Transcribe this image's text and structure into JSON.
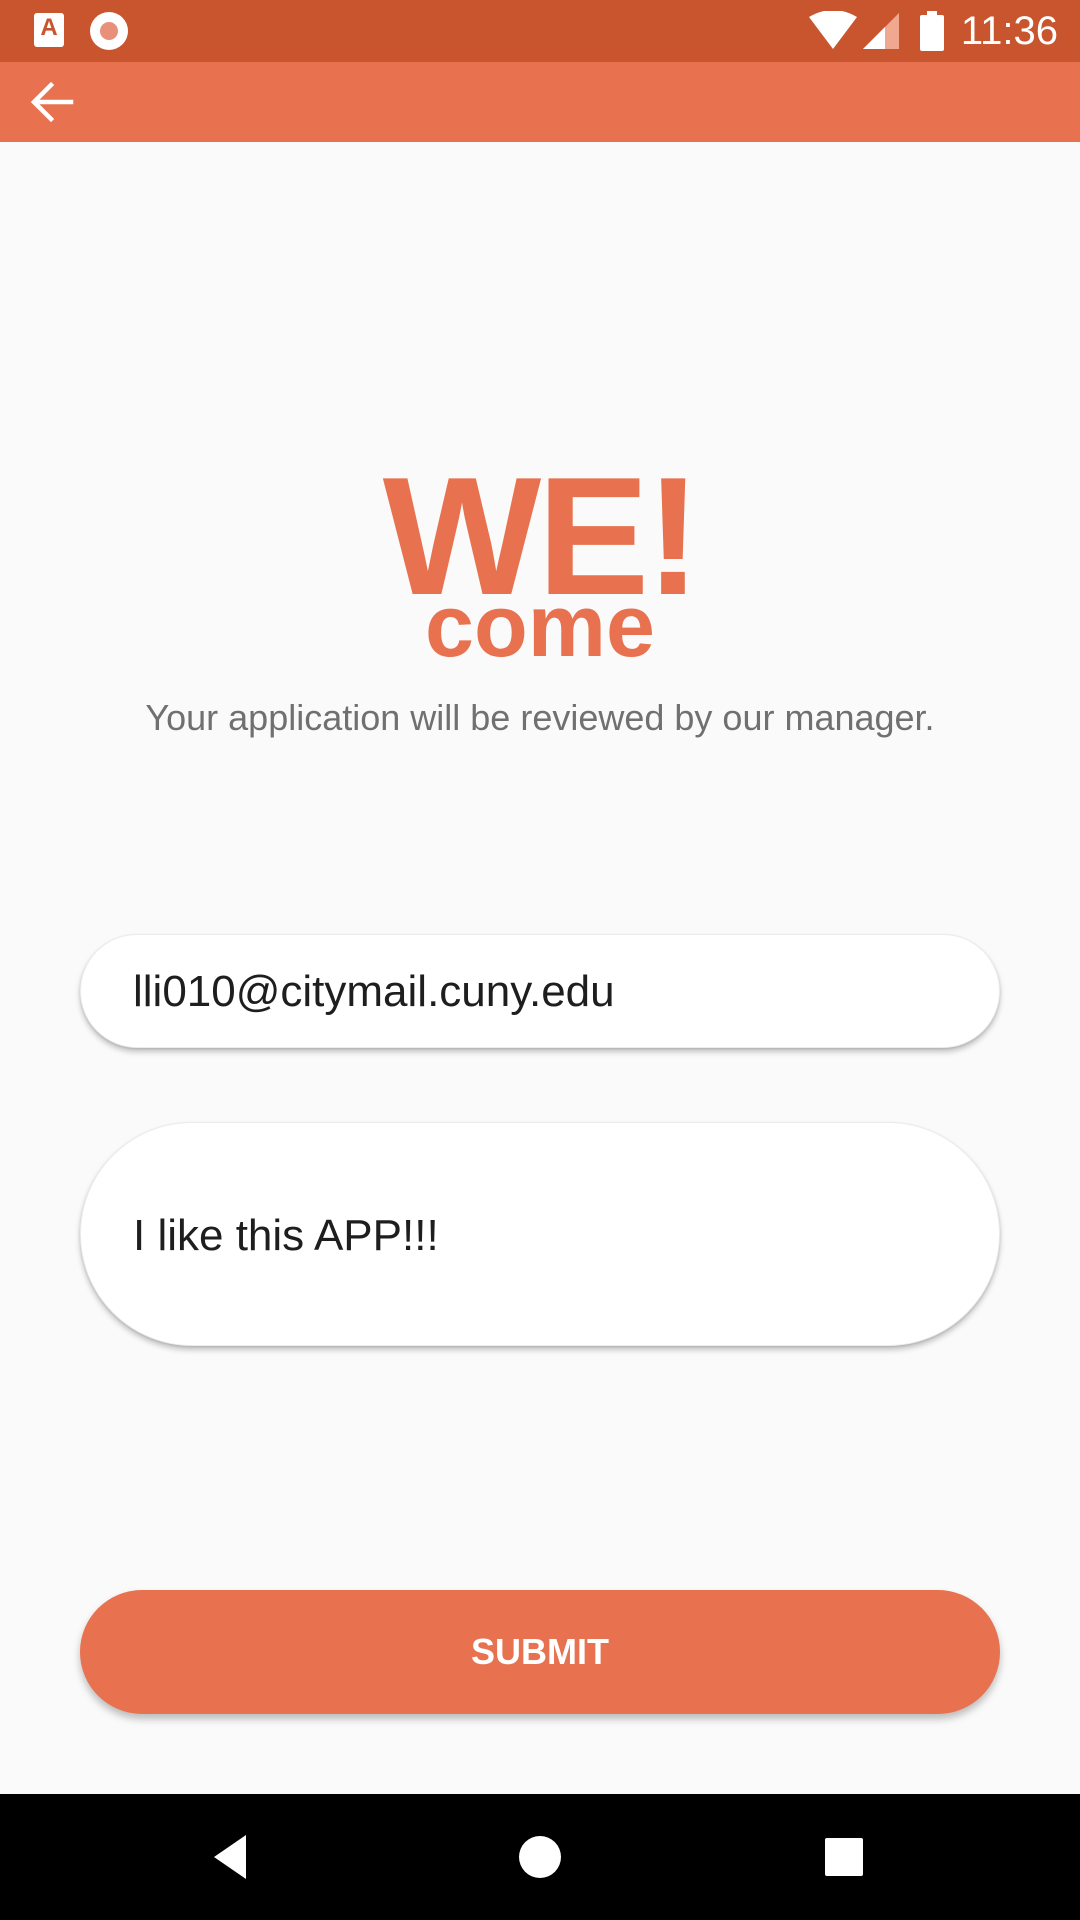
{
  "status_bar": {
    "time": "11:36",
    "icons": [
      "app-a-icon",
      "record-icon",
      "wifi-icon",
      "signal-icon",
      "battery-icon"
    ]
  },
  "app_bar": {
    "back_icon": "arrow-left-icon"
  },
  "logo": {
    "line1": "WE!",
    "line2": "come"
  },
  "subtitle": "Your application will be reviewed by our manager.",
  "form": {
    "email_value": "lli010@citymail.cuny.edu",
    "message_value": "I like this APP!!!",
    "submit_label": "SUBMIT"
  },
  "nav_bar": {
    "icons": [
      "back-triangle-icon",
      "home-circle-icon",
      "recents-square-icon"
    ]
  },
  "colors": {
    "status_bar": "#c9552f",
    "accent": "#e8724f",
    "background": "#fafafa",
    "subtitle": "#707070"
  }
}
